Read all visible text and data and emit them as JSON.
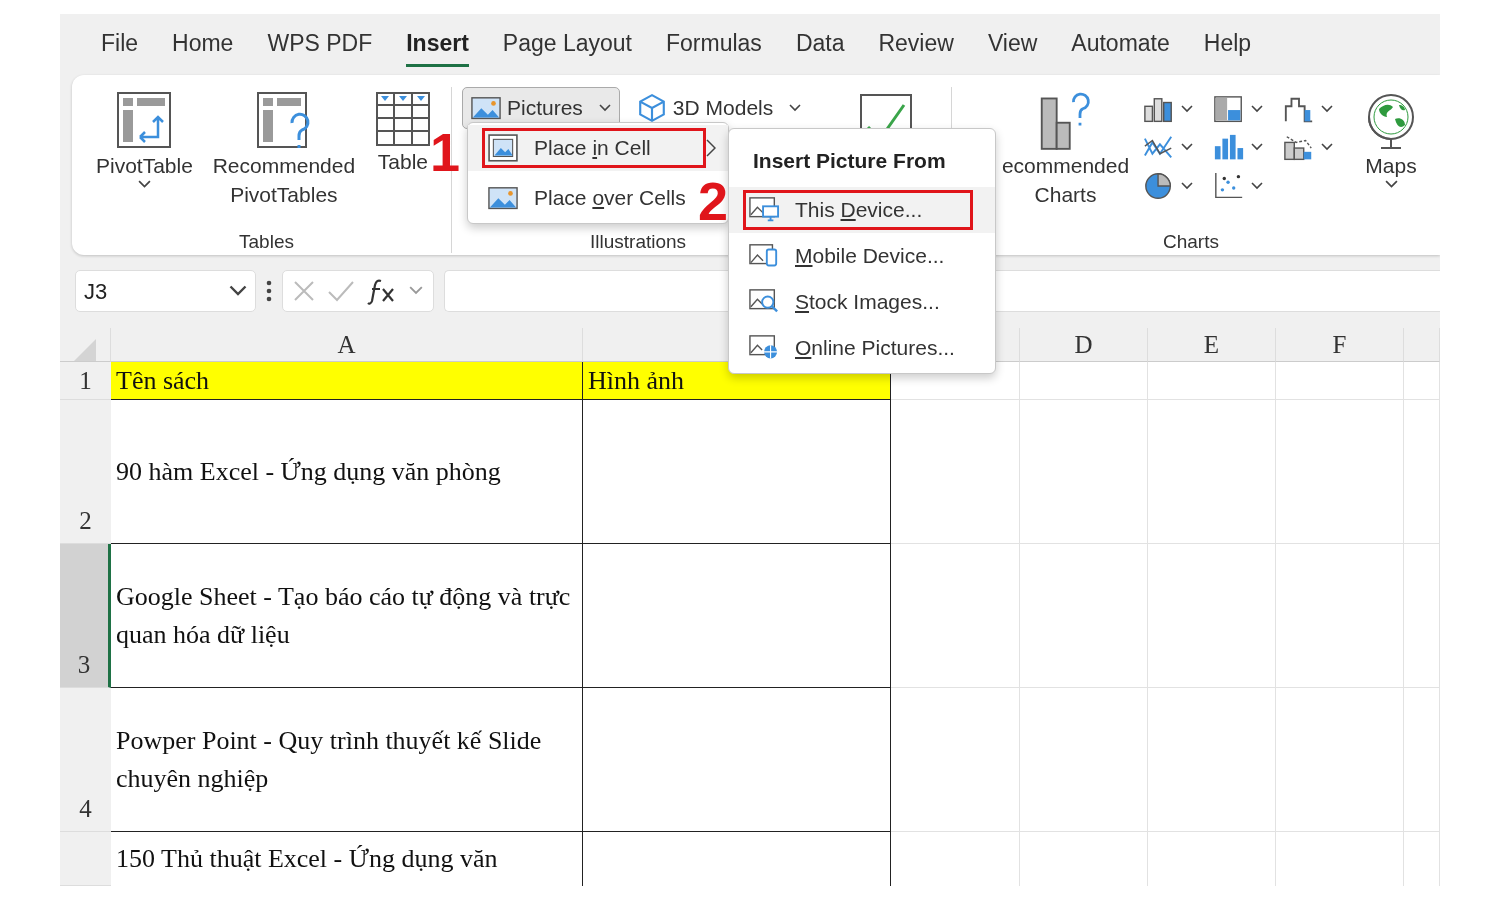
{
  "ribbon_tabs": [
    {
      "label": "File",
      "selected": false
    },
    {
      "label": "Home",
      "selected": false
    },
    {
      "label": "WPS PDF",
      "selected": false
    },
    {
      "label": "Insert",
      "selected": true
    },
    {
      "label": "Page Layout",
      "selected": false
    },
    {
      "label": "Formulas",
      "selected": false
    },
    {
      "label": "Data",
      "selected": false
    },
    {
      "label": "Review",
      "selected": false
    },
    {
      "label": "View",
      "selected": false
    },
    {
      "label": "Automate",
      "selected": false
    },
    {
      "label": "Help",
      "selected": false
    }
  ],
  "ribbon_groups": [
    {
      "label": "Tables",
      "items": [
        {
          "kind": "large",
          "label": "PivotTable",
          "dropdown": true
        },
        {
          "kind": "large",
          "label": "Recommended PivotTables",
          "dropdown": false
        },
        {
          "kind": "large",
          "label": "Table",
          "dropdown": false
        }
      ]
    },
    {
      "label": "Illustrations",
      "items": [
        {
          "kind": "small",
          "label": "Pictures",
          "dropdown": true,
          "pressed": true
        },
        {
          "kind": "small",
          "label": "3D Models",
          "dropdown": true,
          "pressed": false
        },
        {
          "kind": "large",
          "dropdown": false
        }
      ]
    },
    {
      "label": "Charts",
      "items": [
        {
          "kind": "large",
          "label": "ecommended Charts",
          "dropdown": false
        },
        {
          "kind": "icon-grid",
          "icons": [
            {
              "dropdown": true
            },
            {
              "dropdown": true
            },
            {
              "dropdown": true
            },
            {
              "dropdown": true
            },
            {
              "dropdown": true
            },
            {
              "dropdown": true
            },
            {
              "dropdown": true
            },
            {
              "dropdown": true
            }
          ]
        },
        {
          "kind": "large",
          "label": "Maps",
          "dropdown": true
        }
      ]
    }
  ],
  "pictures_menu": {
    "items": [
      {
        "text_before": "Place ",
        "access_key": "i",
        "text_after": "n Cell",
        "selected": true,
        "submenu": true
      },
      {
        "text_before": "Place ",
        "access_key": "o",
        "text_after": "ver Cells",
        "selected": false,
        "submenu": false
      }
    ]
  },
  "insert_picture_submenu": {
    "title": "Insert Picture From",
    "items": [
      {
        "text_before": "This ",
        "access_key": "D",
        "text_after": "evice...",
        "selected": true
      },
      {
        "access_key": "M",
        "text_after": "obile Device...",
        "selected": false
      },
      {
        "access_key": "S",
        "text_after": "tock Images...",
        "selected": false
      },
      {
        "access_key": "O",
        "text_after": "nline Pictures...",
        "selected": false
      }
    ]
  },
  "annotations": [
    {
      "text": "1"
    },
    {
      "text": "2"
    }
  ],
  "formula_bar": {
    "name_box": "J3"
  },
  "sheet": {
    "columns": [
      {
        "header": "A"
      },
      {},
      {},
      {
        "header": "D"
      },
      {
        "header": "E"
      },
      {
        "header": "F"
      },
      {}
    ],
    "rows": [
      {
        "number": "1",
        "kind": "header",
        "selected": false,
        "cells": [
          "Tên sách",
          "Hình ảnh"
        ]
      },
      {
        "number": "2",
        "kind": "data",
        "selected": false,
        "cells": [
          "90 hàm Excel - Ứng dụng văn phòng"
        ]
      },
      {
        "number": "3",
        "kind": "data",
        "selected": true,
        "cells": [
          "Google Sheet - Tạo báo cáo tự động và trực quan hóa dữ liệu"
        ]
      },
      {
        "number": "4",
        "kind": "data",
        "selected": false,
        "cells": [
          "Powper Point - Quy trình thuyết kế Slide chuyên nghiệp"
        ]
      },
      {
        "kind": "data",
        "selected": false,
        "cells": [
          "150 Thủ thuật Excel - Ứng dụng văn"
        ]
      }
    ]
  }
}
